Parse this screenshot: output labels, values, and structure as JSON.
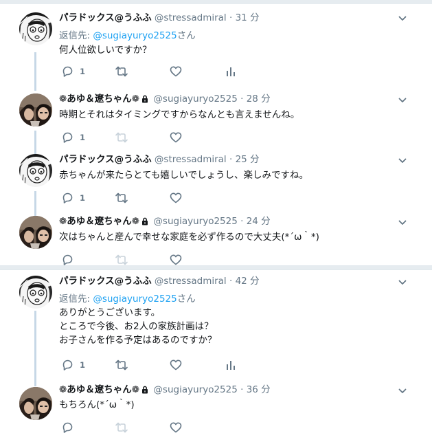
{
  "tweets": [
    {
      "name": "パラドックス@うふふ",
      "handle": "@stressadmiral",
      "dot": "·",
      "time": "31 分",
      "reply_prefix": "返信先: ",
      "reply_handle": "@sugiayuryo2525",
      "reply_suffix": "さん",
      "text": "何人位欲しいですか？",
      "reply_count": "1"
    },
    {
      "name": "❁あゆ＆遼ちゃん❁",
      "handle": "@sugiayuryo2525",
      "dot": "·",
      "time": "28 分",
      "text": "時期とそれはタイミングですからなんとも言えませんね。",
      "reply_count": "1"
    },
    {
      "name": "パラドックス@うふふ",
      "handle": "@stressadmiral",
      "dot": "·",
      "time": "25 分",
      "text": "赤ちゃんが来たらとても嬉しいでしょうし、楽しみですね。",
      "reply_count": "1"
    },
    {
      "name": "❁あゆ＆遼ちゃん❁",
      "handle": "@sugiayuryo2525",
      "dot": "·",
      "time": "24 分",
      "text": "次はちゃんと産んで幸せな家庭を必ず作るので大丈夫(*´ω｀*)",
      "reply_count": ""
    },
    {
      "name": "パラドックス@うふふ",
      "handle": "@stressadmiral",
      "dot": "·",
      "time": "42 分",
      "reply_prefix": "返信先: ",
      "reply_handle": "@sugiayuryo2525",
      "reply_suffix": "さん",
      "text_lines": [
        "ありがとうございます。",
        "ところで今後、お2人の家族計画は？",
        "お子さんを作る予定はあるのですか？"
      ],
      "reply_count": "1"
    },
    {
      "name": "❁あゆ＆遼ちゃん❁",
      "handle": "@sugiayuryo2525",
      "dot": "·",
      "time": "36 分",
      "text": "もちろん(*´ω｀*)",
      "reply_count": ""
    }
  ],
  "icons": {
    "reply": "reply-icon",
    "retweet": "retweet-icon",
    "like": "heart-icon",
    "analytics": "analytics-icon",
    "more": "chevron-down-icon",
    "lock": "lock-icon"
  },
  "colors": {
    "link": "#1da1f2",
    "muted": "#657786",
    "thread_line": "#c6d7e6",
    "separator": "#e6ecf0"
  }
}
